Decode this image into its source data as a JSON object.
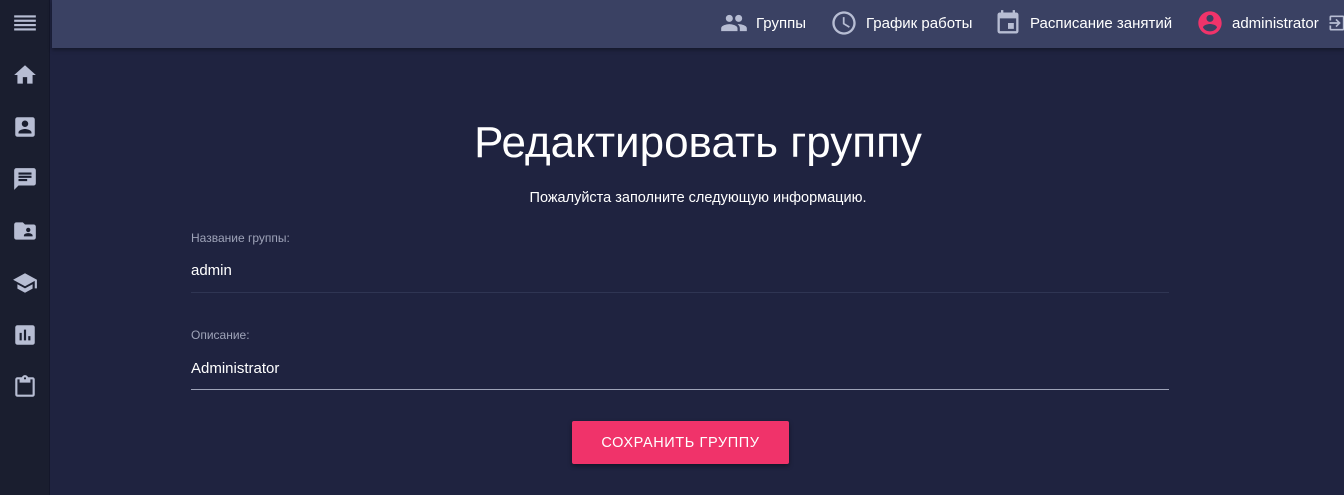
{
  "colors": {
    "background": "#1f2340",
    "sidebar": "#1a1e2f",
    "topbar": "#3a4163",
    "accent": "#f0336a",
    "icon": "#b7bdd3"
  },
  "sidebar": {
    "items": [
      {
        "icon": "menu-icon"
      },
      {
        "icon": "home-icon"
      },
      {
        "icon": "contact-card-icon"
      },
      {
        "icon": "chat-icon"
      },
      {
        "icon": "folder-shared-icon"
      },
      {
        "icon": "school-icon"
      },
      {
        "icon": "chart-icon"
      },
      {
        "icon": "clipboard-icon"
      }
    ]
  },
  "topnav": {
    "groups_label": "Группы",
    "schedule_label": "График работы",
    "timetable_label": "Расписание занятий",
    "user_label": "administrator"
  },
  "form": {
    "title": "Редактировать группу",
    "subtitle": "Пожалуйста заполните следующую информацию.",
    "name_label": "Название группы:",
    "name_value": "admin",
    "description_label": "Описание:",
    "description_value": "Administrator",
    "save_label": "СОХРАНИТЬ ГРУППУ"
  }
}
